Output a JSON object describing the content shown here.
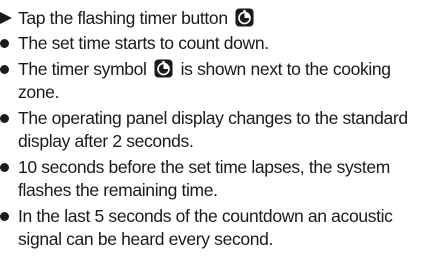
{
  "instructions": {
    "step": {
      "text": "Tap the flashing timer button",
      "icon": "timer-icon"
    },
    "bullets": [
      {
        "lines": [
          "The set time starts to count down."
        ]
      },
      {
        "lines_pre_icon": "The timer symbol",
        "icon": "timer-icon",
        "lines_post_icon": "is shown next to the cooking",
        "lines": [
          "zone."
        ]
      },
      {
        "lines": [
          "The operating panel display changes to the standard",
          "display after 2 seconds."
        ]
      },
      {
        "lines": [
          "10 seconds before the set time lapses, the system",
          "flashes the remaining time."
        ]
      },
      {
        "lines": [
          "In the last 5 seconds of the countdown an acoustic",
          "signal can be heard every second."
        ]
      }
    ]
  }
}
